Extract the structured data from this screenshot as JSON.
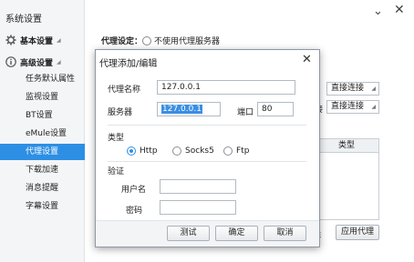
{
  "sidebar": {
    "title": "系统设置",
    "groups": [
      {
        "label": "基本设置",
        "icon": "gear-icon"
      },
      {
        "label": "高级设置",
        "icon": "info-icon"
      }
    ],
    "items": [
      "任务默认属性",
      "监视设置",
      "BT设置",
      "eMule设置",
      "代理设置",
      "下载加速",
      "消息提醒",
      "字幕设置"
    ],
    "active_item": "代理设置"
  },
  "window": {
    "minimize_glyph": "⌄",
    "close_glyph": "✕"
  },
  "proxy_settings": {
    "label": "代理设定：",
    "no_proxy_option": "不使用代理服务器",
    "combo1": "直接连接",
    "combo2_prefix": "接",
    "combo2": "直接连接",
    "table_header": "类型",
    "delete_frag": "除",
    "apply_button": "应用代理"
  },
  "dialog": {
    "title": "代理添加/编辑",
    "close_glyph": "✕",
    "name_label": "代理名称",
    "name_value": "127.0.0.1",
    "server_label": "服务器",
    "server_value": "127.0.0.1",
    "port_label": "端口",
    "port_value": "80",
    "type_label": "类型",
    "types": [
      "Http",
      "Socks5",
      "Ftp"
    ],
    "selected_type": "Http",
    "auth_label": "验证",
    "username_label": "用户名",
    "username_value": "",
    "password_label": "密码",
    "password_value": "",
    "buttons": {
      "test": "测试",
      "ok": "确定",
      "cancel": "取消"
    }
  },
  "colors": {
    "accent": "#2d8fe4",
    "selection": "#3b8ee3"
  }
}
